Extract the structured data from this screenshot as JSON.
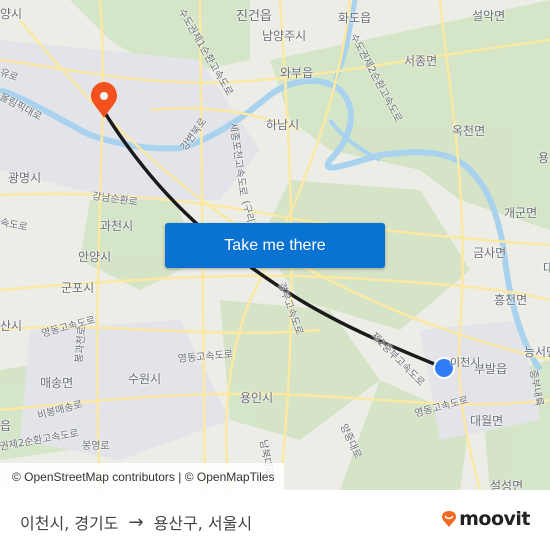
{
  "map": {
    "place_labels": [
      {
        "text": "양시",
        "name": "label-goyang"
      },
      {
        "text": "진건읍",
        "name": "label-jingeon"
      },
      {
        "text": "화도읍",
        "name": "label-hwado"
      },
      {
        "text": "설악면",
        "name": "label-seorak"
      },
      {
        "text": "남양주시",
        "name": "label-namyangju"
      },
      {
        "text": "와부읍",
        "name": "label-wabu"
      },
      {
        "text": "서종면",
        "name": "label-seojong"
      },
      {
        "text": "하남시",
        "name": "label-hanam"
      },
      {
        "text": "옥천면",
        "name": "label-okcheon"
      },
      {
        "text": "광명시",
        "name": "label-gwangmyeong"
      },
      {
        "text": "과천시",
        "name": "label-gwacheon"
      },
      {
        "text": "안양시",
        "name": "label-anyang"
      },
      {
        "text": "군포시",
        "name": "label-gunpo"
      },
      {
        "text": "개군면",
        "name": "label-gaegun"
      },
      {
        "text": "금사면",
        "name": "label-geumsa"
      },
      {
        "text": "흥천면",
        "name": "label-heungcheon"
      },
      {
        "text": "산시",
        "name": "label-ansan"
      },
      {
        "text": "매송면",
        "name": "label-maesong"
      },
      {
        "text": "수원시",
        "name": "label-suwon"
      },
      {
        "text": "용인시",
        "name": "label-yongin"
      },
      {
        "text": "부발읍",
        "name": "label-bubal"
      },
      {
        "text": "능서면",
        "name": "label-neungseo"
      },
      {
        "text": "대월면",
        "name": "label-daewol"
      },
      {
        "text": "설성면",
        "name": "label-seolseong"
      },
      {
        "text": "읍",
        "name": "label-partial-eup"
      },
      {
        "text": "용",
        "name": "label-partial-yong"
      },
      {
        "text": "대",
        "name": "label-partial-dae"
      }
    ],
    "road_labels": [
      {
        "text": "수도권제1순환고속도로",
        "name": "road-label-ring1"
      },
      {
        "text": "수도권제2순환고속도로",
        "name": "road-label-ring2-north"
      },
      {
        "text": "올림픽대로",
        "name": "road-label-olympic"
      },
      {
        "text": "유로",
        "name": "road-label-partial-yuro"
      },
      {
        "text": "강변북로",
        "name": "road-label-gangbyeon"
      },
      {
        "text": "세종포천고속도로",
        "name": "road-label-sejong-pocheon"
      },
      {
        "text": "(구리포천)",
        "name": "road-label-guri"
      },
      {
        "text": "강남순환로",
        "name": "road-label-gangnam-ring"
      },
      {
        "text": "속도로",
        "name": "road-label-partial-expressway"
      },
      {
        "text": "영동고속도로",
        "name": "road-label-yeongdong-west"
      },
      {
        "text": "봉과천로",
        "name": "road-label-bonggwacheon"
      },
      {
        "text": "비봉매송로",
        "name": "road-label-bibong"
      },
      {
        "text": "권제2순환고속도로",
        "name": "road-label-ring2-south"
      },
      {
        "text": "봉영로",
        "name": "road-label-bongyeong"
      },
      {
        "text": "영동고속도로",
        "name": "road-label-yeongdong-mid"
      },
      {
        "text": "경부고속도로",
        "name": "road-label-gyeongbu"
      },
      {
        "text": "제2중부고속도로",
        "name": "road-label-jungbu2"
      },
      {
        "text": "남북대로",
        "name": "road-label-nambuk"
      },
      {
        "text": "양중대로",
        "name": "road-label-yangjung"
      },
      {
        "text": "영동고속도로",
        "name": "road-label-yeongdong-east"
      },
      {
        "text": "중부내륙",
        "name": "road-label-jungbu-naeryuk"
      }
    ],
    "origin_label_partial": "이천시",
    "cta_label": "Take me there",
    "attribution": "© OpenStreetMap contributors | © OpenMapTiles",
    "colors": {
      "destination_pin": "#f2501c",
      "origin_dot": "#2e7cf6",
      "route_line": "#1a1a1a",
      "cta_background": "#0a72d1",
      "water": "#a8d2ee",
      "road": "#fdf0b0",
      "park": "#cfe0be"
    }
  },
  "footer": {
    "origin": "이천시, 경기도",
    "arrow": "→",
    "destination": "용산구, 서울시",
    "brand": "moovit",
    "brand_color": "#f56a21"
  }
}
